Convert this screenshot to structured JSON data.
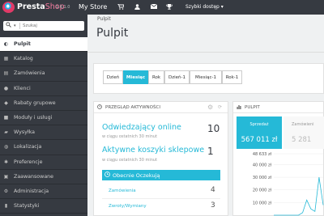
{
  "topbar": {
    "brand_bold": "Presta",
    "brand_rest": "Shop",
    "version": "1.6.1.0",
    "store": "My Store",
    "icons": [
      "cart-icon",
      "user-icon",
      "mail-icon",
      "trophy-icon"
    ],
    "quick_access": "Szybki dostęp ▾"
  },
  "sidebar": {
    "search_placeholder": "Szukaj",
    "items": [
      {
        "label": "Pulpit",
        "icon": "dashboard-icon",
        "active": true
      },
      {
        "label": "Katalog",
        "icon": "catalog-icon"
      },
      {
        "label": "Zamówienia",
        "icon": "orders-icon"
      },
      {
        "label": "Klienci",
        "icon": "customers-icon"
      },
      {
        "label": "Rabaty grupowe",
        "icon": "discount-icon"
      },
      {
        "label": "Moduły i usługi",
        "icon": "modules-icon"
      },
      {
        "label": "Wysyłka",
        "icon": "shipping-icon"
      },
      {
        "label": "Lokalizacja",
        "icon": "globe-icon"
      },
      {
        "label": "Preferencje",
        "icon": "preferences-icon"
      },
      {
        "label": "Zaawansowane",
        "icon": "advanced-icon"
      },
      {
        "label": "Administracja",
        "icon": "admin-icon"
      },
      {
        "label": "Statystyki",
        "icon": "stats-icon"
      }
    ]
  },
  "header": {
    "breadcrumb": "Pulpit",
    "title": "Pulpit"
  },
  "period": {
    "buttons": [
      {
        "label": "Dzień"
      },
      {
        "label": "Miesiąc",
        "active": true
      },
      {
        "label": "Rok"
      },
      {
        "label": "Dzień-1"
      },
      {
        "label": "Miesiąc-1"
      },
      {
        "label": "Rok-1"
      }
    ]
  },
  "activity": {
    "title": "PRZEGLĄD AKTYWNOŚCI",
    "visitors_label": "Odwiedzający online",
    "visitors_sub": "w ciągu ostatnich 30 minut",
    "visitors_value": "10",
    "carts_label": "Aktywne koszyki sklepowe",
    "carts_sub": "w ciągu ostatnich 30 minut",
    "carts_value": "1",
    "pending_label": "Obecnie Oczekują",
    "orders_label": "Zamówienia",
    "orders_value": "4",
    "returns_label": "Zwroty/Wymiany",
    "returns_value": "3"
  },
  "dashboard": {
    "title": "PULPIT",
    "sales_label": "Sprzedaż",
    "sales_value": "567 011 zł",
    "orders_label": "Zamówieni",
    "orders_value": "5 281",
    "colors": {
      "accent": "#25b9d7",
      "sidebar": "#363a41",
      "brand_pink": "#f5799f"
    }
  },
  "chart_data": {
    "type": "line",
    "title": "",
    "xlabel": "",
    "ylabel": "",
    "yticks": [
      "48 633 zł",
      "40 000 zł",
      "30 000 zł",
      "20 000 zł",
      "10 000 zł"
    ],
    "ylim": [
      0,
      48633
    ],
    "series": [
      {
        "color": "#25b9d7",
        "x": [
          0,
          1,
          2,
          3,
          4,
          5,
          6,
          7,
          8,
          9,
          10,
          11,
          12
        ],
        "values": [
          0,
          0,
          0,
          0,
          0,
          0,
          0,
          2000,
          12000,
          5000,
          3000,
          30000,
          8000
        ]
      }
    ],
    "grid": true
  }
}
